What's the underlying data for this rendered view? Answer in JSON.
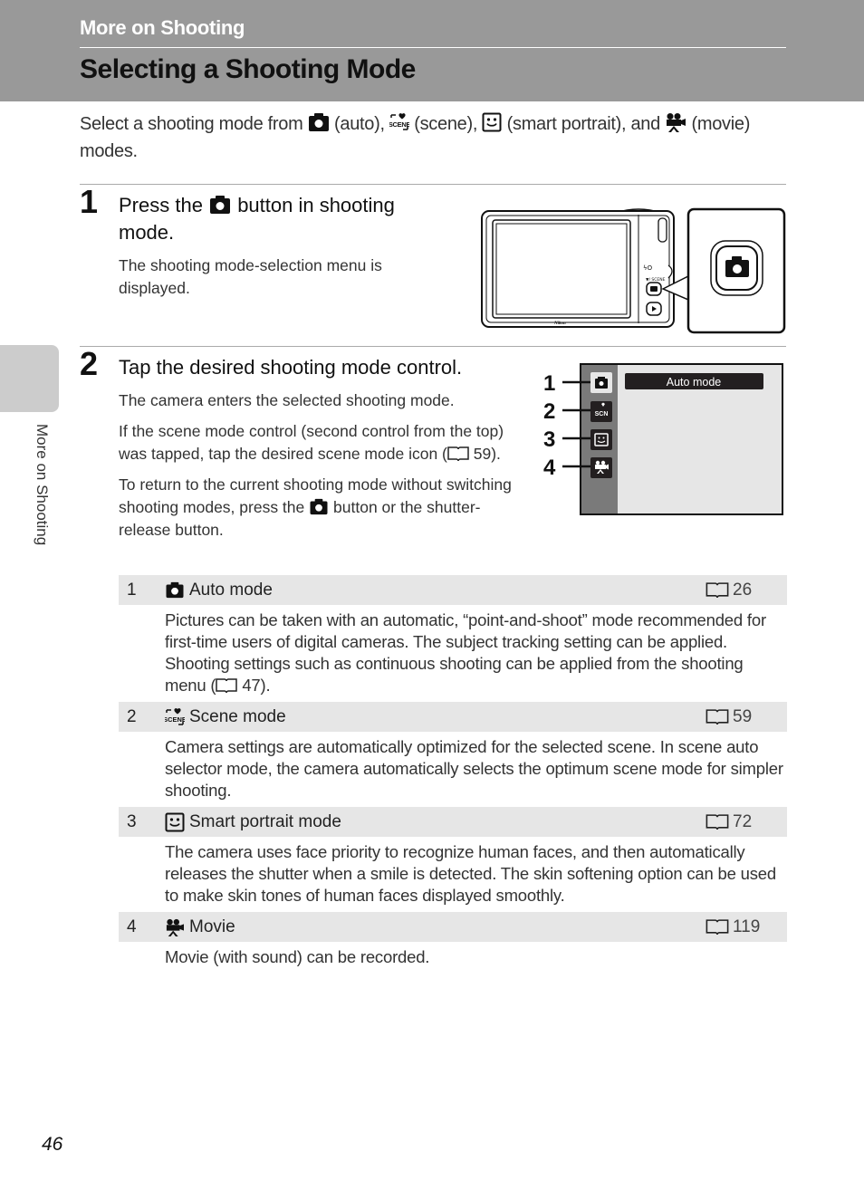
{
  "header": {
    "section_title": "More on Shooting",
    "page_title": "Selecting a Shooting Mode"
  },
  "intro": {
    "part1": "Select a shooting mode from",
    "part2": "(auto),",
    "part3": "(scene),",
    "part4": "(smart portrait), and",
    "part5": "(movie) modes."
  },
  "steps": [
    {
      "number": "1",
      "heading_before": "Press the",
      "heading_after": "button in shooting mode.",
      "body": [
        "The shooting mode-selection menu is displayed."
      ]
    },
    {
      "number": "2",
      "heading": "Tap the desired shooting mode control.",
      "body_1": "The camera enters the selected shooting mode.",
      "body_2_before": "If the scene mode control (second control from the top) was tapped, tap the desired scene mode icon (",
      "body_2_ref": "59",
      "body_2_after": ").",
      "body_3_before": "To return to the current shooting mode without switching shooting modes, press the",
      "body_3_after": "button or the shutter-release button."
    }
  ],
  "side_tab": {
    "label": "More on Shooting"
  },
  "camera_figure": {
    "brand": "Nikon"
  },
  "menu_figure": {
    "selected_label": "Auto mode",
    "callouts": [
      "1",
      "2",
      "3",
      "4"
    ],
    "controls": [
      "camera-icon",
      "scene-icon",
      "smart-portrait-icon",
      "movie-icon"
    ]
  },
  "modes": [
    {
      "number": "1",
      "icon": "camera-icon",
      "title": "Auto mode",
      "page_ref": "26",
      "description_before": "Pictures can be taken with an automatic, “point-and-shoot” mode recommended for first-time users of digital cameras. The subject tracking setting can be applied. Shooting settings such as continuous shooting can be applied from the shooting menu (",
      "description_ref": "47",
      "description_after": ")."
    },
    {
      "number": "2",
      "icon": "scene-icon",
      "title": "Scene mode",
      "page_ref": "59",
      "description": "Camera settings are automatically optimized for the selected scene. In scene auto selector mode, the camera automatically selects the optimum scene mode for simpler shooting."
    },
    {
      "number": "3",
      "icon": "smart-portrait-icon",
      "title": "Smart portrait mode",
      "page_ref": "72",
      "description": "The camera uses face priority to recognize human faces, and then automatically releases the shutter when a smile is detected. The skin softening option can be used to make skin tones of human faces displayed smoothly."
    },
    {
      "number": "4",
      "icon": "movie-icon",
      "title": "Movie",
      "page_ref": "119",
      "description": "Movie (with sound) can be recorded."
    }
  ],
  "footer": {
    "page_number": "46"
  }
}
